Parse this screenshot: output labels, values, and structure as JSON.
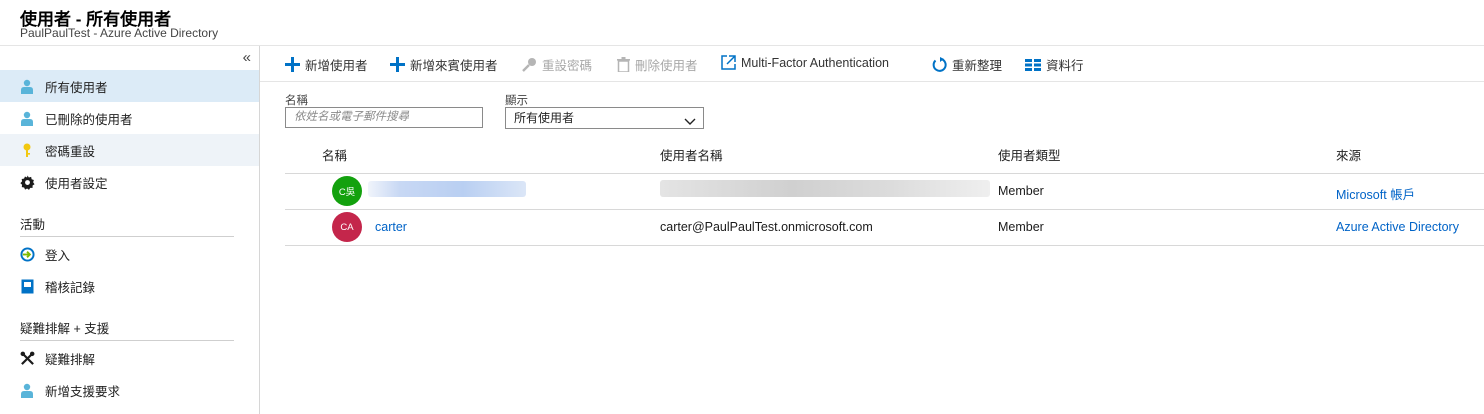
{
  "header": {
    "title": "使用者 - 所有使用者",
    "subtitle": "PaulPaulTest - Azure Active Directory"
  },
  "sidebar": {
    "collapse_glyph": "«",
    "items": [
      {
        "label": "所有使用者",
        "icon": "user-icon",
        "state": "active"
      },
      {
        "label": "已刪除的使用者",
        "icon": "user-icon"
      },
      {
        "label": "密碼重設",
        "icon": "key-icon",
        "state": "hover"
      },
      {
        "label": "使用者設定",
        "icon": "gear-icon"
      }
    ],
    "sections": [
      {
        "title": "活動",
        "items": [
          {
            "label": "登入",
            "icon": "sign-in-icon"
          },
          {
            "label": "稽核記錄",
            "icon": "audit-log-icon"
          }
        ]
      },
      {
        "title": "疑難排解 + 支援",
        "items": [
          {
            "label": "疑難排解",
            "icon": "wrench-icon"
          },
          {
            "label": "新增支援要求",
            "icon": "support-user-icon"
          }
        ]
      }
    ]
  },
  "toolbar": {
    "new_user": "新增使用者",
    "new_guest": "新增來賓使用者",
    "reset_password": "重設密碼",
    "delete_user": "刪除使用者",
    "mfa": "Multi-Factor Authentication",
    "refresh": "重新整理",
    "columns": "資料行"
  },
  "filters": {
    "name_label": "名稱",
    "name_placeholder": "依姓名或電子郵件搜尋",
    "show_label": "顯示",
    "show_value": "所有使用者"
  },
  "table": {
    "headers": [
      "名稱",
      "使用者名稱",
      "使用者類型",
      "來源"
    ],
    "rows": [
      {
        "initials": "C吳",
        "avatar_color": "#13a10e",
        "name": "",
        "username": "",
        "type": "Member",
        "source": "Microsoft 帳戶",
        "redacted": true
      },
      {
        "initials": "CA",
        "avatar_color": "#c4264b",
        "name": "carter",
        "username": "carter@PaulPaulTest.onmicrosoft.com",
        "type": "Member",
        "source": "Azure Active Directory",
        "redacted": false
      }
    ]
  },
  "colors": {
    "accent": "#0063c7",
    "active_bg": "#dcebf7"
  }
}
